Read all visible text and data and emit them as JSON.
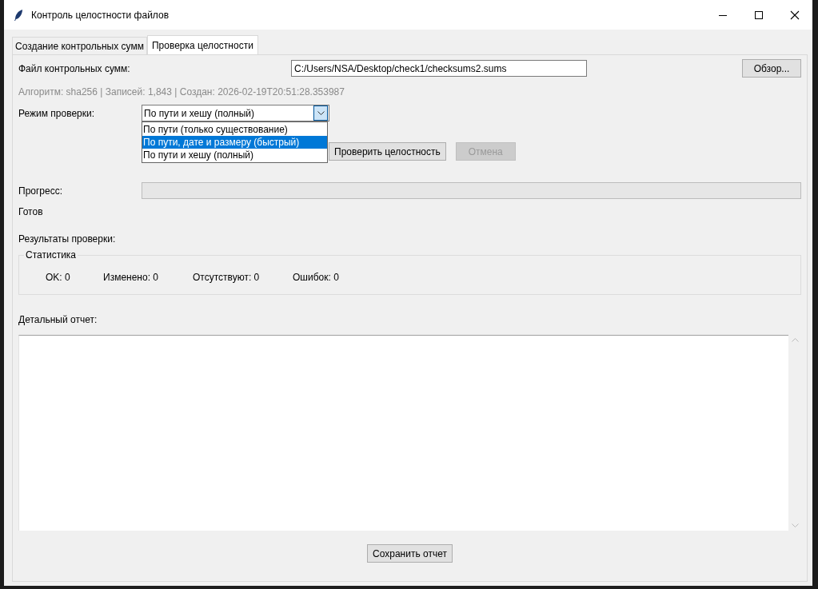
{
  "window": {
    "title": "Контроль целостности файлов"
  },
  "tabs": [
    {
      "label": "Создание контрольных сумм",
      "selected": false
    },
    {
      "label": "Проверка целостности",
      "selected": true
    }
  ],
  "checksum_file": {
    "label": "Файл контрольных сумм:",
    "value": "C:/Users/NSA/Desktop/check1/checksums2.sums",
    "browse_button": "Обзор..."
  },
  "info": "Алгоритм: sha256 | Записей: 1,843 | Создан: 2026-02-19T20:51:28.353987",
  "mode": {
    "label": "Режим проверки:",
    "value": "По пути и хешу (полный)",
    "expanded": true,
    "options": [
      {
        "label": "По пути (только существование)",
        "highlighted": false
      },
      {
        "label": "По пути, дате и размеру (быстрый)",
        "highlighted": true
      },
      {
        "label": "По пути и хешу (полный)",
        "highlighted": false
      }
    ]
  },
  "actions": [
    {
      "label": "Проверить целостность",
      "disabled": false
    },
    {
      "label": "Отмена",
      "disabled": true
    }
  ],
  "progress": {
    "label": "Прогресс:",
    "level": 0,
    "status": "Готов"
  },
  "results_label": "Результаты проверки:",
  "statistics": {
    "title": "Статистика",
    "items": [
      "OK: 0",
      "Изменено: 0",
      "Отсутствуют: 0",
      "Ошибок: 0"
    ]
  },
  "report": {
    "label": "Детальный отчет:"
  },
  "save_button": "Сохранить отчет"
}
